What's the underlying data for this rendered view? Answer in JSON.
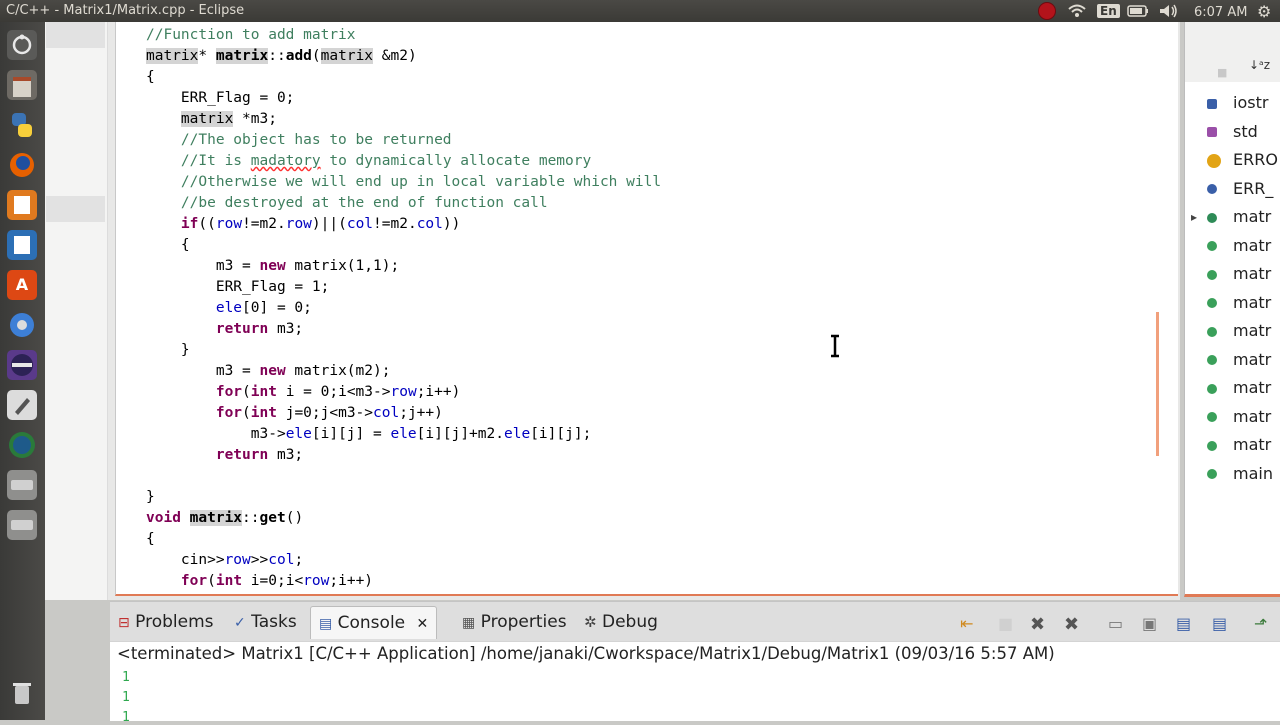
{
  "window": {
    "title": "C/C++ - Matrix1/Matrix.cpp - Eclipse"
  },
  "tray": {
    "keyboard": "En",
    "time": "6:07 AM"
  },
  "code": [
    "//Function to add matrix",
    "matrix* matrix::add(matrix &m2)",
    "{",
    "    ERR_Flag = 0;",
    "    matrix *m3;",
    "    //The object has to be returned",
    "    //It is madatory to dynamically allocate memory",
    "    //Otherwise we will end up in local variable which will",
    "    //be destroyed at the end of function call",
    "    if((row!=m2.row)||(col!=m2.col))",
    "    {",
    "        m3 = new matrix(1,1);",
    "        ERR_Flag = 1;",
    "        ele[0] = 0;",
    "        return m3;",
    "    }",
    "        m3 = new matrix(m2);",
    "        for(int i = 0;i<m3->row;i++)",
    "        for(int j=0;j<m3->col;j++)",
    "            m3->ele[i][j] = ele[i][j]+m2.ele[i][j];",
    "        return m3;",
    "",
    "}",
    "void matrix::get()",
    "{",
    "    cin>>row>>col;",
    "    for(int i=0;i<row;i++)"
  ],
  "outline": {
    "items": [
      {
        "label": "iostr",
        "color": "#3a5fa8",
        "shape": "include"
      },
      {
        "label": "std",
        "color": "#9a4fa8",
        "shape": "namespace"
      },
      {
        "label": "ERRO",
        "color": "#e2a416",
        "shape": "typedef"
      },
      {
        "label": "ERR_",
        "color": "#3a5fa8",
        "shape": "variable"
      },
      {
        "label": "matr",
        "color": "#2e8b57",
        "shape": "class"
      },
      {
        "label": "matr",
        "color": "#3aa05a",
        "shape": "method"
      },
      {
        "label": "matr",
        "color": "#3aa05a",
        "shape": "method"
      },
      {
        "label": "matr",
        "color": "#3aa05a",
        "shape": "method"
      },
      {
        "label": "matr",
        "color": "#3aa05a",
        "shape": "method"
      },
      {
        "label": "matr",
        "color": "#3aa05a",
        "shape": "method"
      },
      {
        "label": "matr",
        "color": "#3aa05a",
        "shape": "method"
      },
      {
        "label": "matr",
        "color": "#3aa05a",
        "shape": "method"
      },
      {
        "label": "matr",
        "color": "#3aa05a",
        "shape": "constructor"
      },
      {
        "label": "main",
        "color": "#3aa05a",
        "shape": "function"
      }
    ]
  },
  "bottom_tabs": {
    "problems": "Problems",
    "tasks": "Tasks",
    "console": "Console",
    "console_close": "✕",
    "properties": "Properties",
    "debug": "Debug"
  },
  "console": {
    "header": "<terminated> Matrix1 [C/C++ Application] /home/janaki/Cworkspace/Matrix1/Debug/Matrix1 (09/03/16 5:57 AM)",
    "lines": [
      "1",
      "1",
      "1"
    ]
  }
}
